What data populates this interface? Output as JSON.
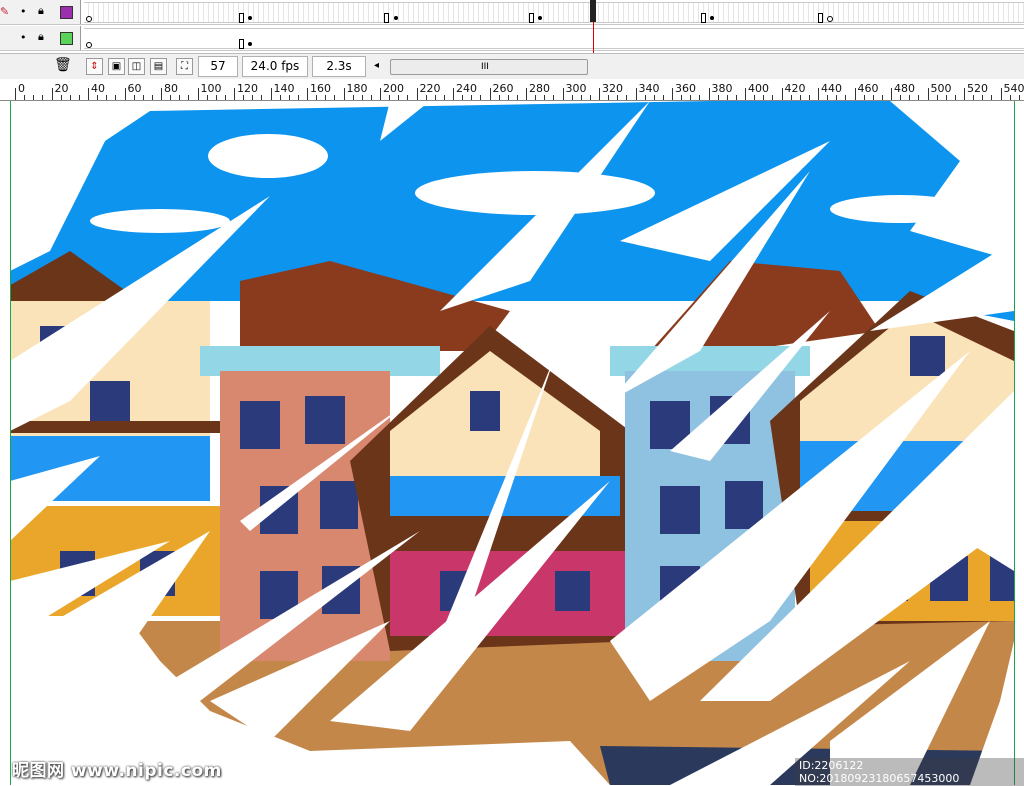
{
  "timeline": {
    "layers": [
      {
        "head_color": "#9b2fae",
        "keyframe_color": "#000000"
      },
      {
        "head_color": "#5ad35a",
        "keyframe_color": "#000000"
      }
    ]
  },
  "controls": {
    "current_frame": "57",
    "frame_rate": "24.0 fps",
    "elapsed_time": "2.3s",
    "scroll_grip": "III"
  },
  "ruler": {
    "labels": [
      "0",
      "20",
      "40",
      "60",
      "80",
      "100",
      "120",
      "140",
      "160",
      "180",
      "200",
      "220",
      "240",
      "260",
      "280",
      "300",
      "320",
      "340",
      "360",
      "380",
      "400",
      "420",
      "440",
      "460",
      "480",
      "500",
      "520",
      "540"
    ]
  },
  "stage": {
    "sky_color": "#0d94ee",
    "ground_color": "#c4874a"
  },
  "watermark": {
    "site": "昵图网 www.nipic.com",
    "id_text": "ID:2206122 NO:20180923180657453000"
  }
}
